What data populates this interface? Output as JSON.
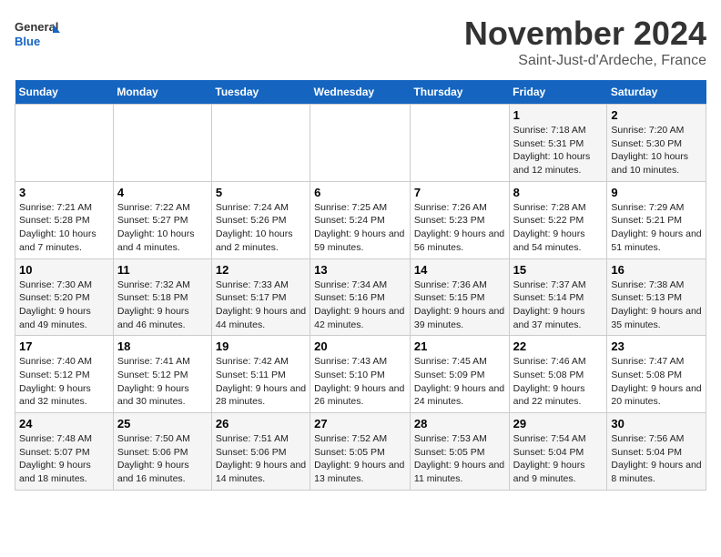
{
  "logo": {
    "line1": "General",
    "line2": "Blue"
  },
  "header": {
    "month": "November 2024",
    "location": "Saint-Just-d'Ardeche, France"
  },
  "weekdays": [
    "Sunday",
    "Monday",
    "Tuesday",
    "Wednesday",
    "Thursday",
    "Friday",
    "Saturday"
  ],
  "weeks": [
    [
      {
        "day": "",
        "info": ""
      },
      {
        "day": "",
        "info": ""
      },
      {
        "day": "",
        "info": ""
      },
      {
        "day": "",
        "info": ""
      },
      {
        "day": "",
        "info": ""
      },
      {
        "day": "1",
        "info": "Sunrise: 7:18 AM\nSunset: 5:31 PM\nDaylight: 10 hours and 12 minutes."
      },
      {
        "day": "2",
        "info": "Sunrise: 7:20 AM\nSunset: 5:30 PM\nDaylight: 10 hours and 10 minutes."
      }
    ],
    [
      {
        "day": "3",
        "info": "Sunrise: 7:21 AM\nSunset: 5:28 PM\nDaylight: 10 hours and 7 minutes."
      },
      {
        "day": "4",
        "info": "Sunrise: 7:22 AM\nSunset: 5:27 PM\nDaylight: 10 hours and 4 minutes."
      },
      {
        "day": "5",
        "info": "Sunrise: 7:24 AM\nSunset: 5:26 PM\nDaylight: 10 hours and 2 minutes."
      },
      {
        "day": "6",
        "info": "Sunrise: 7:25 AM\nSunset: 5:24 PM\nDaylight: 9 hours and 59 minutes."
      },
      {
        "day": "7",
        "info": "Sunrise: 7:26 AM\nSunset: 5:23 PM\nDaylight: 9 hours and 56 minutes."
      },
      {
        "day": "8",
        "info": "Sunrise: 7:28 AM\nSunset: 5:22 PM\nDaylight: 9 hours and 54 minutes."
      },
      {
        "day": "9",
        "info": "Sunrise: 7:29 AM\nSunset: 5:21 PM\nDaylight: 9 hours and 51 minutes."
      }
    ],
    [
      {
        "day": "10",
        "info": "Sunrise: 7:30 AM\nSunset: 5:20 PM\nDaylight: 9 hours and 49 minutes."
      },
      {
        "day": "11",
        "info": "Sunrise: 7:32 AM\nSunset: 5:18 PM\nDaylight: 9 hours and 46 minutes."
      },
      {
        "day": "12",
        "info": "Sunrise: 7:33 AM\nSunset: 5:17 PM\nDaylight: 9 hours and 44 minutes."
      },
      {
        "day": "13",
        "info": "Sunrise: 7:34 AM\nSunset: 5:16 PM\nDaylight: 9 hours and 42 minutes."
      },
      {
        "day": "14",
        "info": "Sunrise: 7:36 AM\nSunset: 5:15 PM\nDaylight: 9 hours and 39 minutes."
      },
      {
        "day": "15",
        "info": "Sunrise: 7:37 AM\nSunset: 5:14 PM\nDaylight: 9 hours and 37 minutes."
      },
      {
        "day": "16",
        "info": "Sunrise: 7:38 AM\nSunset: 5:13 PM\nDaylight: 9 hours and 35 minutes."
      }
    ],
    [
      {
        "day": "17",
        "info": "Sunrise: 7:40 AM\nSunset: 5:12 PM\nDaylight: 9 hours and 32 minutes."
      },
      {
        "day": "18",
        "info": "Sunrise: 7:41 AM\nSunset: 5:12 PM\nDaylight: 9 hours and 30 minutes."
      },
      {
        "day": "19",
        "info": "Sunrise: 7:42 AM\nSunset: 5:11 PM\nDaylight: 9 hours and 28 minutes."
      },
      {
        "day": "20",
        "info": "Sunrise: 7:43 AM\nSunset: 5:10 PM\nDaylight: 9 hours and 26 minutes."
      },
      {
        "day": "21",
        "info": "Sunrise: 7:45 AM\nSunset: 5:09 PM\nDaylight: 9 hours and 24 minutes."
      },
      {
        "day": "22",
        "info": "Sunrise: 7:46 AM\nSunset: 5:08 PM\nDaylight: 9 hours and 22 minutes."
      },
      {
        "day": "23",
        "info": "Sunrise: 7:47 AM\nSunset: 5:08 PM\nDaylight: 9 hours and 20 minutes."
      }
    ],
    [
      {
        "day": "24",
        "info": "Sunrise: 7:48 AM\nSunset: 5:07 PM\nDaylight: 9 hours and 18 minutes."
      },
      {
        "day": "25",
        "info": "Sunrise: 7:50 AM\nSunset: 5:06 PM\nDaylight: 9 hours and 16 minutes."
      },
      {
        "day": "26",
        "info": "Sunrise: 7:51 AM\nSunset: 5:06 PM\nDaylight: 9 hours and 14 minutes."
      },
      {
        "day": "27",
        "info": "Sunrise: 7:52 AM\nSunset: 5:05 PM\nDaylight: 9 hours and 13 minutes."
      },
      {
        "day": "28",
        "info": "Sunrise: 7:53 AM\nSunset: 5:05 PM\nDaylight: 9 hours and 11 minutes."
      },
      {
        "day": "29",
        "info": "Sunrise: 7:54 AM\nSunset: 5:04 PM\nDaylight: 9 hours and 9 minutes."
      },
      {
        "day": "30",
        "info": "Sunrise: 7:56 AM\nSunset: 5:04 PM\nDaylight: 9 hours and 8 minutes."
      }
    ]
  ]
}
